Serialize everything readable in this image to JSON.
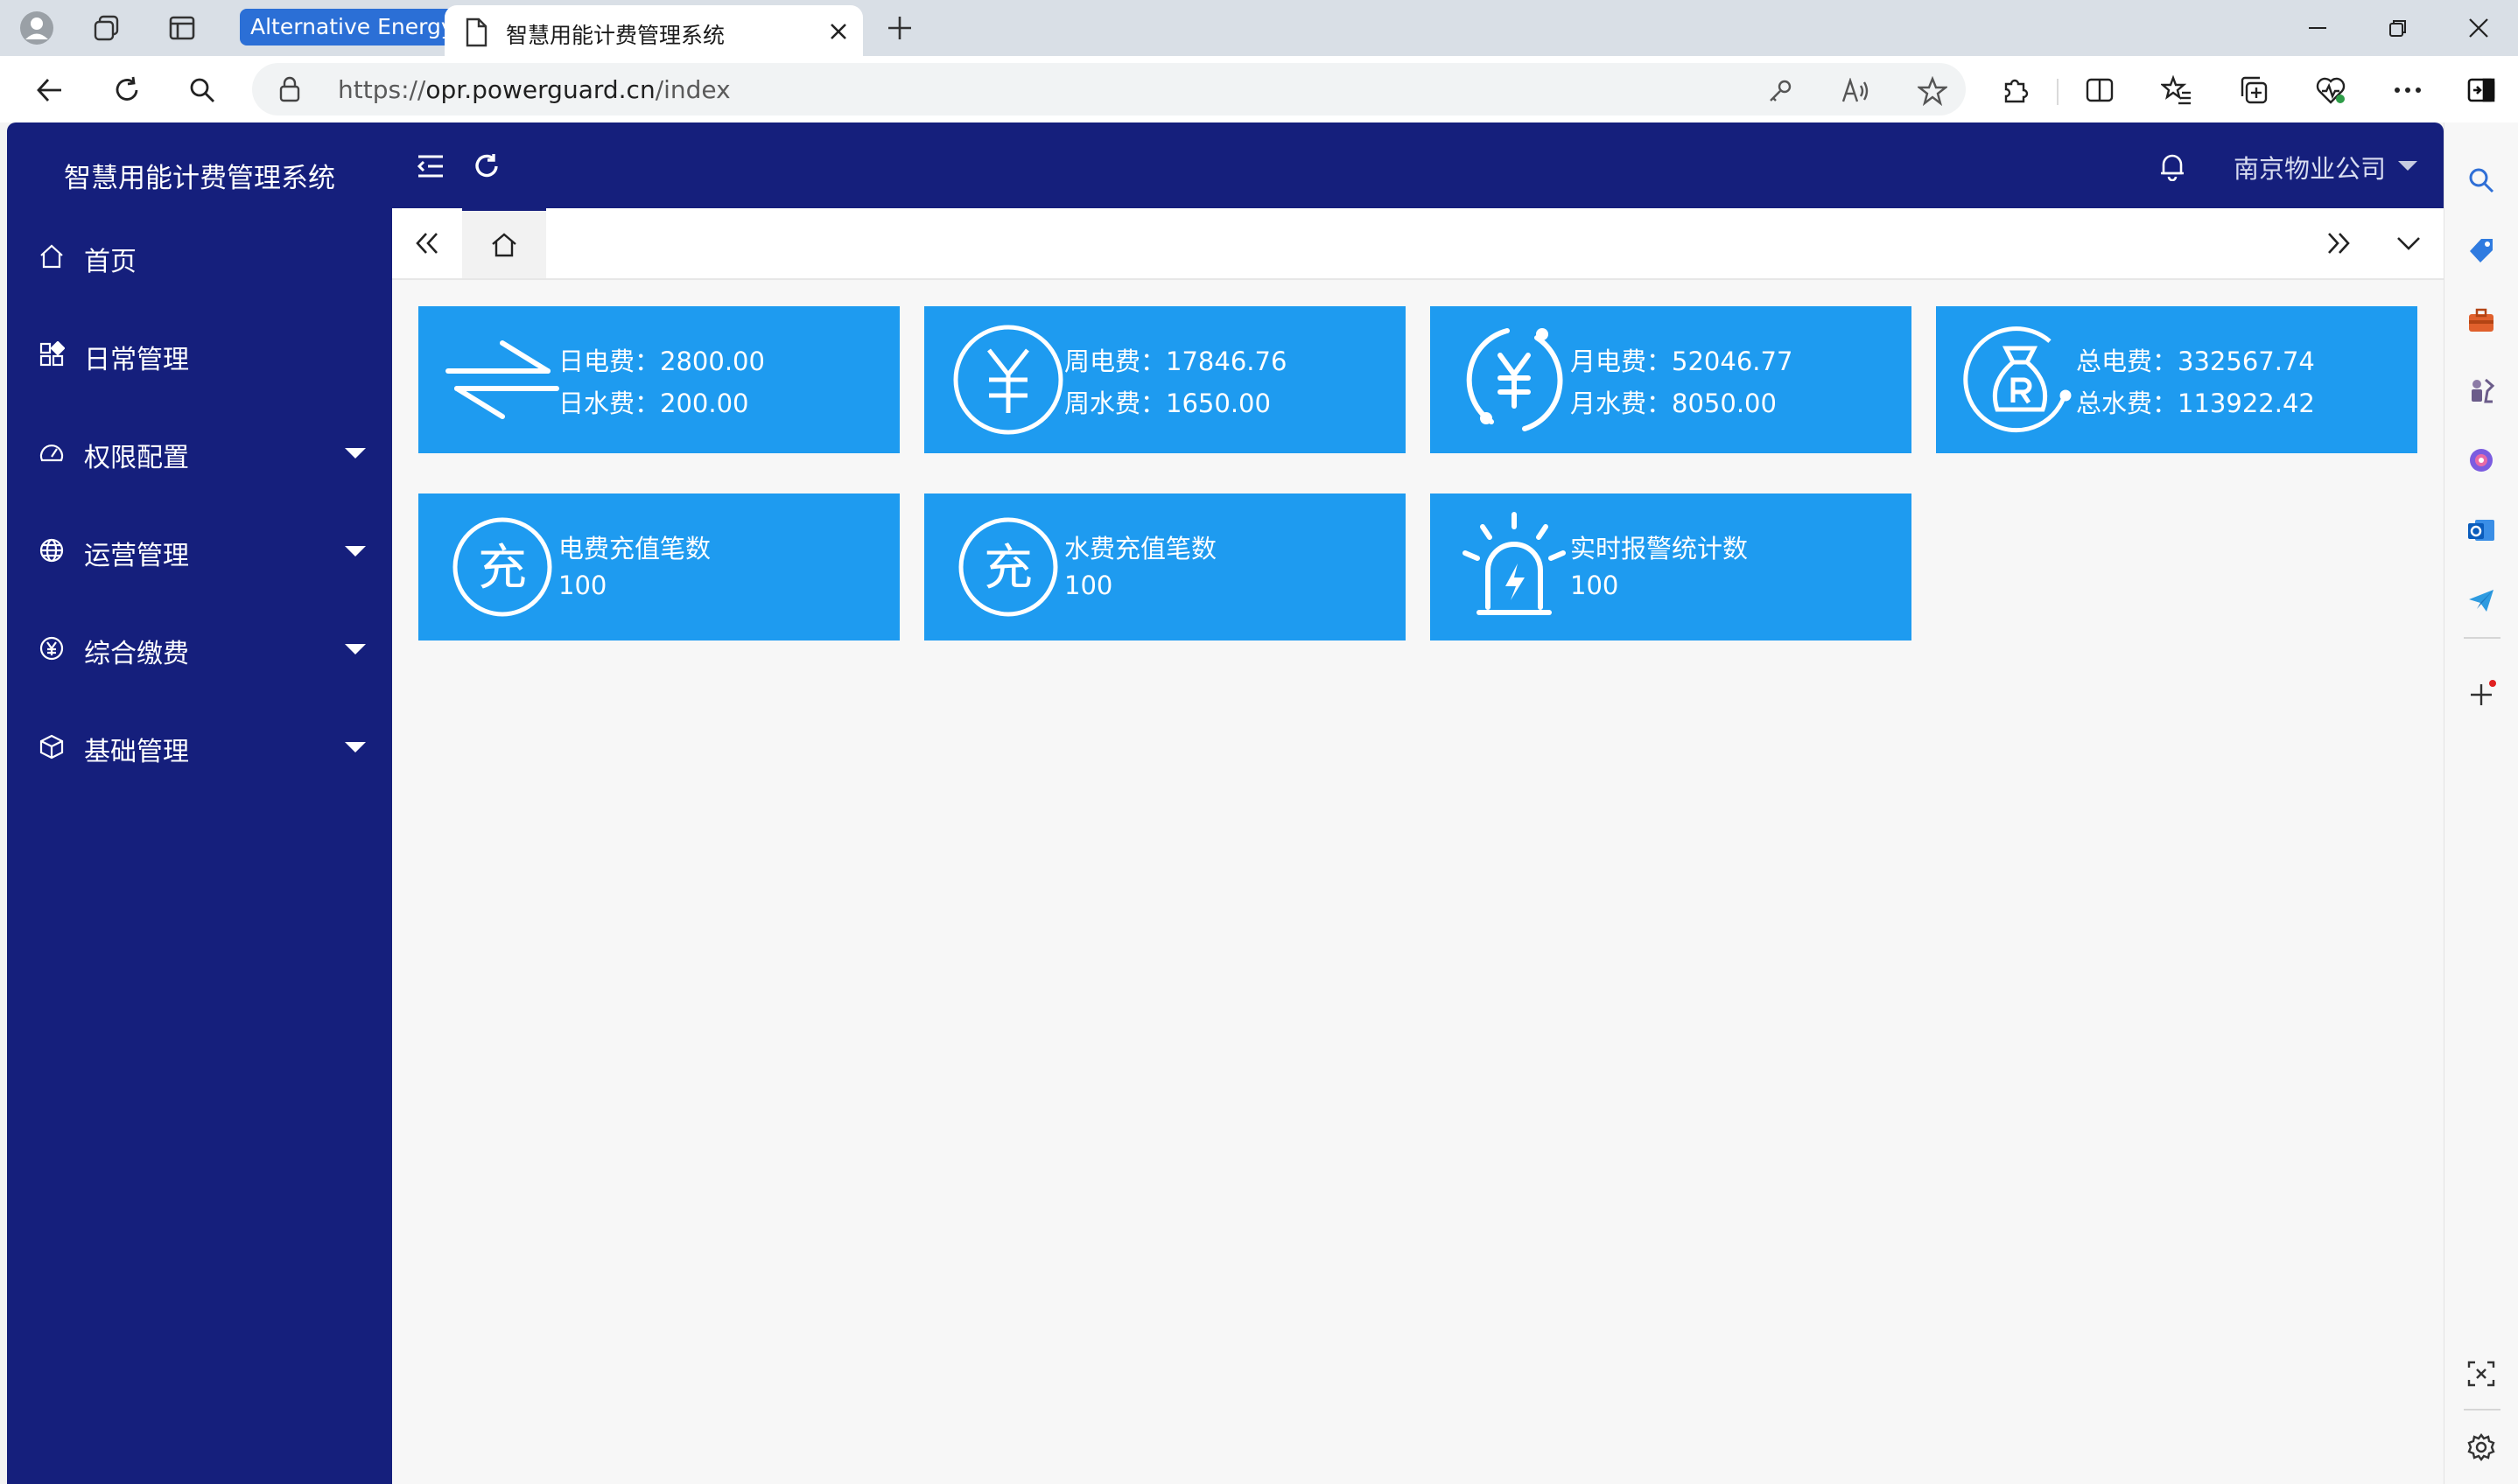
{
  "browser": {
    "tab_group_label": "Alternative Energy",
    "active_tab_title": "智慧用能计费管理系统",
    "url_prefix": "https://",
    "url_host": "opr.powerguard.cn",
    "url_path": "/index"
  },
  "app": {
    "title": "智慧用能计费管理系统",
    "company": "南京物业公司",
    "menu": [
      {
        "label": "首页",
        "icon": "home-icon",
        "has_children": false
      },
      {
        "label": "日常管理",
        "icon": "apps-icon",
        "has_children": false
      },
      {
        "label": "权限配置",
        "icon": "dashboard-icon",
        "has_children": true
      },
      {
        "label": "运营管理",
        "icon": "globe-icon",
        "has_children": true
      },
      {
        "label": "综合缴费",
        "icon": "yen-circle-icon",
        "has_children": true
      },
      {
        "label": "基础管理",
        "icon": "cube-icon",
        "has_children": true
      }
    ]
  },
  "stats": {
    "day": {
      "elec_label": "日电费：",
      "elec_value": "2800.00",
      "water_label": "日水费：",
      "water_value": "200.00"
    },
    "week": {
      "elec_label": "周电费：",
      "elec_value": "17846.76",
      "water_label": "周水费：",
      "water_value": "1650.00"
    },
    "month": {
      "elec_label": "月电费：",
      "elec_value": "52046.77",
      "water_label": "月水费：",
      "water_value": "8050.00"
    },
    "total": {
      "elec_label": "总电费：",
      "elec_value": "332567.74",
      "water_label": "总水费：",
      "water_value": "113922.42"
    },
    "elec_recharge": {
      "label": "电费充值笔数",
      "value": "100",
      "icon_char": "充"
    },
    "water_recharge": {
      "label": "水费充值笔数",
      "value": "100",
      "icon_char": "充"
    },
    "alarms": {
      "label": "实时报警统计数",
      "value": "100"
    }
  },
  "colors": {
    "sidebar": "#151f7c",
    "card": "#1e9bf0",
    "tab_group": "#2b6fd6"
  }
}
